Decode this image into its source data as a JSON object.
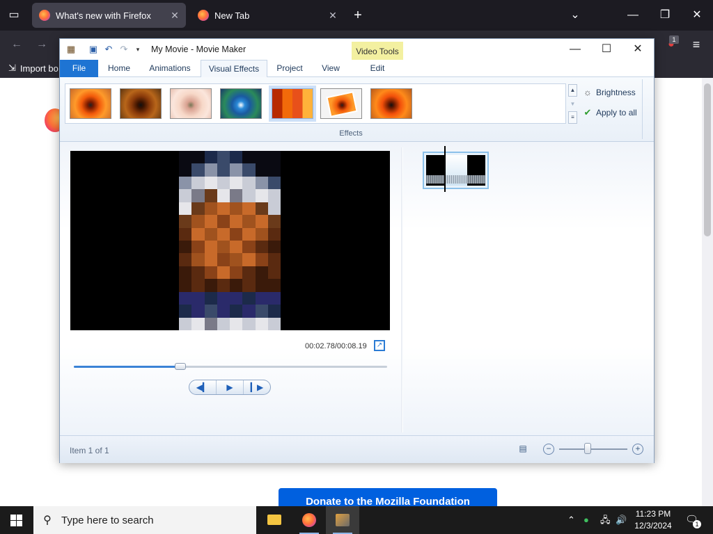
{
  "browser": {
    "tabs": [
      {
        "title": "What's new with Firefox",
        "active": true
      },
      {
        "title": "New Tab",
        "active": false
      }
    ],
    "bookmarks_label": "Import bo",
    "page_button": "Donate to the Mozilla Foundation",
    "icons": {
      "tab_list": "tab-list-icon",
      "new_tab": "plus-icon",
      "list_all": "chevron-down-icon",
      "back": "back-arrow-icon",
      "forward": "forward-arrow-icon",
      "menu": "hamburger-menu-icon",
      "extension": "ublock-icon"
    },
    "extension_badge": "1"
  },
  "movie_maker": {
    "title": "My Movie - Movie Maker",
    "contextual_group": "Video Tools",
    "tabs": [
      "File",
      "Home",
      "Animations",
      "Visual Effects",
      "Project",
      "View",
      "Edit"
    ],
    "active_tab": "Visual Effects",
    "ribbon": {
      "group_label": "Effects",
      "brightness_label": "Brightness",
      "apply_all_label": "Apply to all",
      "effects_count": 7,
      "selected_effect_index": 4
    },
    "preview": {
      "timecode": "00:02.78/00:08.19",
      "seek_fraction": 0.34
    },
    "status": {
      "item_text": "Item 1 of 1",
      "zoom_fraction": 0.42
    }
  },
  "taskbar": {
    "search_placeholder": "Type here to search",
    "time": "11:23 PM",
    "date": "12/3/2024",
    "notification_count": "1"
  },
  "colors": {
    "file_tab": "#1e74d3",
    "context_tools": "#f3f0a0",
    "donate": "#0060df",
    "taskbar": "#1b1b1b"
  }
}
